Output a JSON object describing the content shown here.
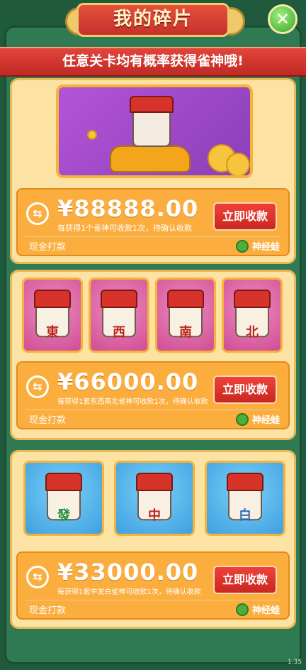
{
  "header": {
    "title": "我的碎片",
    "close_icon": "close-icon"
  },
  "ribbon": {
    "text": "任意关卡均有概率获得雀神哦!"
  },
  "cards": [
    {
      "amount": "¥88888.00",
      "description": "每获得1个雀神可收款1次，待确认收款",
      "button": "立即收款",
      "pay_label": "现金打款",
      "partner": "神经蛙"
    },
    {
      "amount": "¥66000.00",
      "description": "每获得1套东西南北雀神可收款1次，待确认收款",
      "button": "立即收款",
      "pay_label": "现金打款",
      "partner": "神经蛙",
      "tiles": [
        "東",
        "西",
        "南",
        "北"
      ]
    },
    {
      "amount": "¥33000.00",
      "description": "每获得1套中发白雀神可收款1次，待确认收款",
      "button": "立即收款",
      "pay_label": "现金打款",
      "partner": "神经蛙",
      "tiles": [
        "發",
        "中",
        "白"
      ]
    }
  ],
  "version": "1.35",
  "colors": {
    "accent": "#e2443a",
    "gold": "#f5b33a",
    "background": "#2f7a52"
  }
}
